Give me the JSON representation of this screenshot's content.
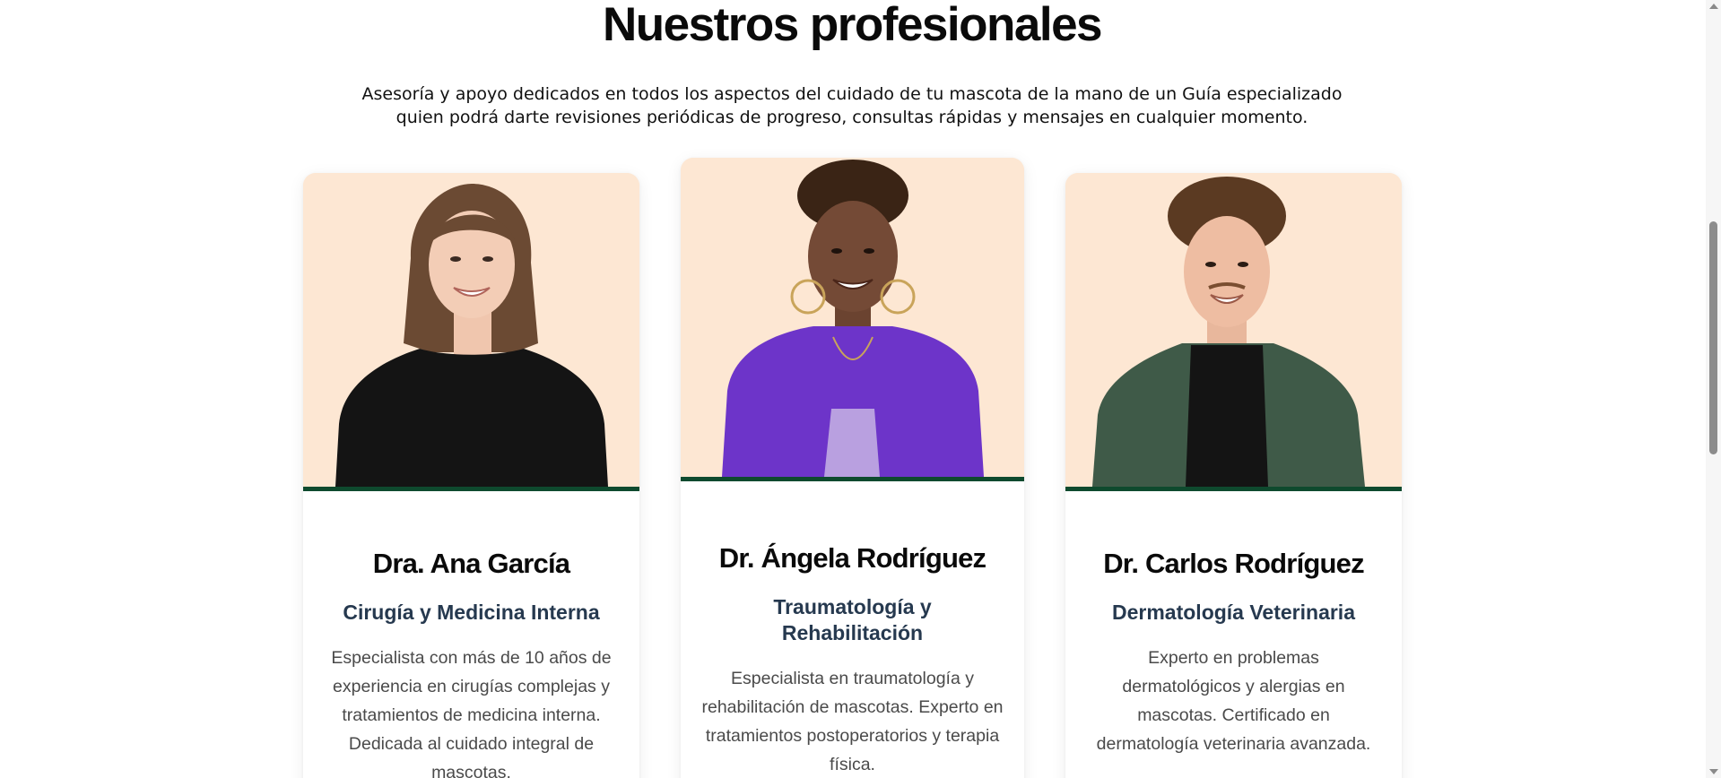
{
  "section": {
    "title": "Nuestros profesionales",
    "subtitle": "Asesoría y apoyo dedicados en todos los aspectos del cuidado de tu mascota de la mano de un Guía especializado quien podrá darte revisiones periódicas de progreso, consultas rápidas y mensajes en cualquier momento."
  },
  "professionals": [
    {
      "name": "Dra. Ana García",
      "specialty": "Cirugía y Medicina Interna",
      "description": "Especialista con más de 10 años de experiencia en cirugías complejas y tratamientos de medicina interna. Dedicada al cuidado integral de mascotas."
    },
    {
      "name": "Dr. Ángela Rodríguez",
      "specialty": "Traumatología y Rehabilitación",
      "description": "Especialista en traumatología y rehabilitación de mascotas. Experto en tratamientos postoperatorios y terapia física."
    },
    {
      "name": "Dr. Carlos Rodríguez",
      "specialty": "Dermatología Veterinaria",
      "description": "Experto en problemas dermatológicos y alergias en mascotas. Certificado en dermatología veterinaria avanzada."
    }
  ],
  "colors": {
    "photo_background": "#fde7d3",
    "photo_accent_border": "#0e4a2e",
    "specialty_text": "#26394f",
    "description_text": "#4a4a4a"
  }
}
